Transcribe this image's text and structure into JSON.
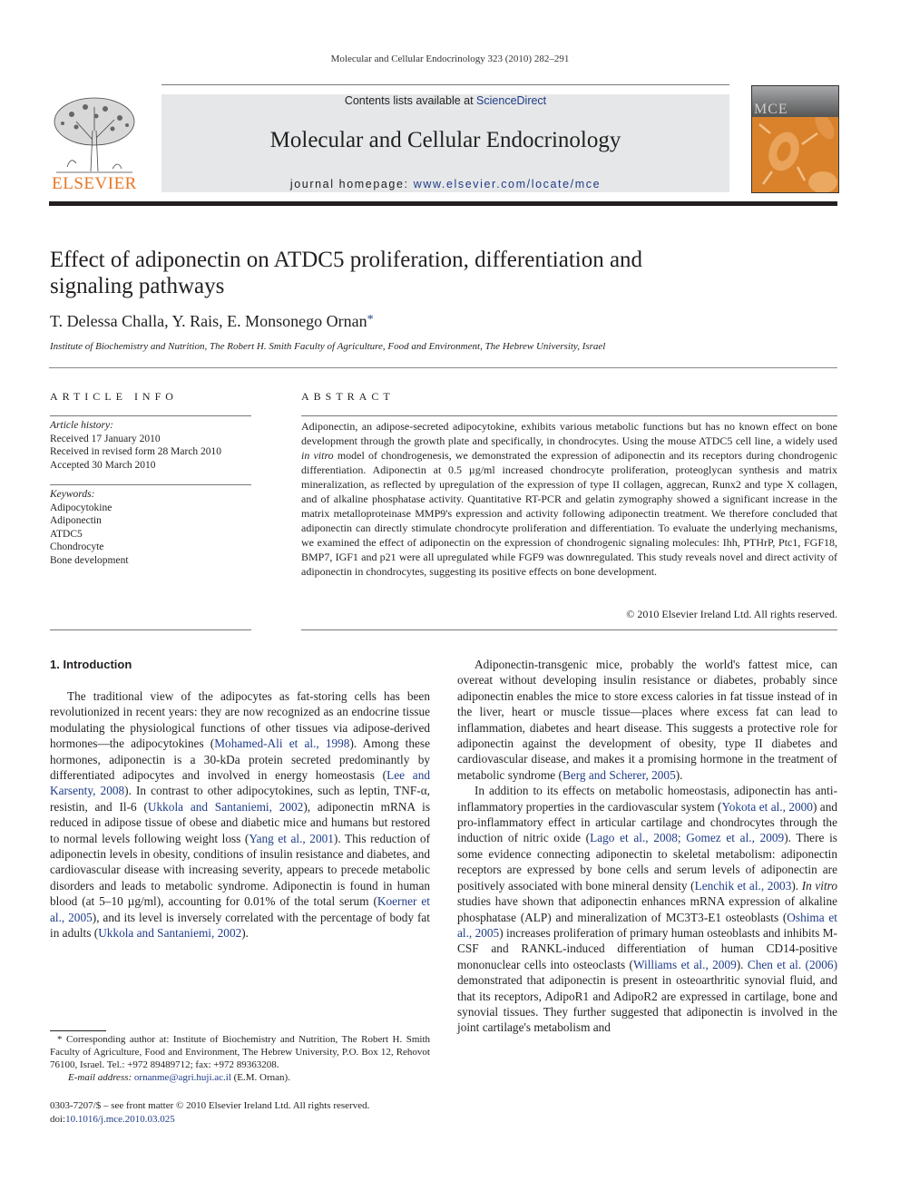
{
  "running_head": "Molecular and Cellular Endocrinology 323 (2010) 282–291",
  "banner": {
    "contents_prefix": "Contents lists available at ",
    "contents_link": "ScienceDirect",
    "journal_title": "Molecular and Cellular Endocrinology",
    "homepage_prefix": "journal homepage: ",
    "homepage_link": "www.elsevier.com/locate/mce"
  },
  "publisher_logo_text": "ELSEVIER",
  "cover": {
    "label": "MCE"
  },
  "article": {
    "title": "Effect of adiponectin on ATDC5 proliferation, differentiation and signaling pathways",
    "authors": "T. Delessa Challa, Y. Rais, E. Monsonego Ornan",
    "author_mark": "*",
    "affiliation": "Institute of Biochemistry and Nutrition, The Robert H. Smith Faculty of Agriculture, Food and Environment, The Hebrew University, Israel"
  },
  "article_info": {
    "heading": "ARTICLE INFO",
    "history_label": "Article history:",
    "history": [
      "Received 17 January 2010",
      "Received in revised form 28 March 2010",
      "Accepted 30 March 2010"
    ],
    "keywords_label": "Keywords:",
    "keywords": [
      "Adipocytokine",
      "Adiponectin",
      "ATDC5",
      "Chondrocyte",
      "Bone development"
    ]
  },
  "abstract": {
    "heading": "ABSTRACT",
    "text_1": "Adiponectin, an adipose-secreted adipocytokine, exhibits various metabolic functions but has no known effect on bone development through the growth plate and specifically, in chondrocytes. Using the mouse ATDC5 cell line, a widely used ",
    "text_italic": "in vitro",
    "text_2": " model of chondrogenesis, we demonstrated the expression of adiponectin and its receptors during chondrogenic differentiation. Adiponectin at 0.5 µg/ml increased chondrocyte proliferation, proteoglycan synthesis and matrix mineralization, as reflected by upregulation of the expression of type II collagen, aggrecan, Runx2 and type X collagen, and of alkaline phosphatase activity. Quantitative RT-PCR and gelatin zymography showed a significant increase in the matrix metalloproteinase MMP9's expression and activity following adiponectin treatment. We therefore concluded that adiponectin can directly stimulate chondrocyte proliferation and differentiation. To evaluate the underlying mechanisms, we examined the effect of adiponectin on the expression of chondrogenic signaling molecules: Ihh, PTHrP, Ptc1, FGF18, BMP7, IGF1 and p21 were all upregulated while FGF9 was downregulated. This study reveals novel and direct activity of adiponectin in chondrocytes, suggesting its positive effects on bone development.",
    "copyright": "© 2010 Elsevier Ireland Ltd. All rights reserved."
  },
  "intro": {
    "heading": "1.  Introduction",
    "left_p1": [
      {
        "t": "The traditional view of the adipocytes as fat-storing cells has been revolutionized in recent years: they are now recognized as an endocrine tissue modulating the physiological functions of other tissues via adipose-derived hormones—the adipocytokines ("
      },
      {
        "r": "Mohamed-Ali et al., 1998"
      },
      {
        "t": "). Among these hormones, adiponectin is a 30-kDa protein secreted predominantly by differentiated adipocytes and involved in energy homeostasis ("
      },
      {
        "r": "Lee and Karsenty, 2008"
      },
      {
        "t": "). In contrast to other adipocytokines, such as leptin, TNF-α, resistin, and Il-6 ("
      },
      {
        "r": "Ukkola and Santaniemi, 2002"
      },
      {
        "t": "), adiponectin mRNA is reduced in adipose tissue of obese and diabetic mice and humans but restored to normal levels following weight loss ("
      },
      {
        "r": "Yang et al., 2001"
      },
      {
        "t": "). This reduction of adiponectin levels in obesity, conditions of insulin resistance and diabetes, and cardiovascular disease with increasing severity, appears to precede metabolic disorders and leads to metabolic syndrome. Adiponectin is found in human blood (at 5–10 µg/ml), accounting for 0.01% of the total serum ("
      },
      {
        "r": "Koerner et al., 2005"
      },
      {
        "t": "), and its level is inversely correlated with the percentage of body fat in adults ("
      },
      {
        "r": "Ukkola and Santaniemi, 2002"
      },
      {
        "t": ")."
      }
    ],
    "right_p1": [
      {
        "t": "Adiponectin-transgenic mice, probably the world's fattest mice, can overeat without developing insulin resistance or diabetes, probably since adiponectin enables the mice to store excess calories in fat tissue instead of in the liver, heart or muscle tissue—places where excess fat can lead to inflammation, diabetes and heart disease. This suggests a protective role for adiponectin against the development of obesity, type II diabetes and cardiovascular disease, and makes it a promising hormone in the treatment of metabolic syndrome ("
      },
      {
        "r": "Berg and Scherer, 2005"
      },
      {
        "t": ")."
      }
    ],
    "right_p2": [
      {
        "t": "In addition to its effects on metabolic homeostasis, adiponectin has anti-inflammatory properties in the cardiovascular system ("
      },
      {
        "r": "Yokota et al., 2000"
      },
      {
        "t": ") and pro-inflammatory effect in articular cartilage and chondrocytes through the induction of nitric oxide ("
      },
      {
        "r": "Lago et al., 2008; Gomez et al., 2009"
      },
      {
        "t": "). There is some evidence connecting adiponectin to skeletal metabolism: adiponectin receptors are expressed by bone cells and serum levels of adiponectin are positively associated with bone mineral density ("
      },
      {
        "r": "Lenchik et al., 2003"
      },
      {
        "t": "). "
      },
      {
        "i": "In vitro"
      },
      {
        "t": " studies have shown that adiponectin enhances mRNA expression of alkaline phosphatase (ALP) and mineralization of MC3T3-E1 osteoblasts ("
      },
      {
        "r": "Oshima et al., 2005"
      },
      {
        "t": ") increases proliferation of primary human osteoblasts and inhibits M-CSF and RANKL-induced differentiation of human CD14-positive mononuclear cells into osteoclasts ("
      },
      {
        "r": "Williams et al., 2009"
      },
      {
        "t": "). "
      },
      {
        "r": "Chen et al. (2006)"
      },
      {
        "t": " demonstrated that adiponectin is present in osteoarthritic synovial fluid, and that its receptors, AdipoR1 and AdipoR2 are expressed in cartilage, bone and synovial tissues. They further suggested that adiponectin is involved in the joint cartilage's metabolism and"
      }
    ]
  },
  "footnote": {
    "corresponding": "* Corresponding author at: Institute of Biochemistry and Nutrition, The Robert H. Smith Faculty of Agriculture, Food and Environment, The Hebrew University, P.O. Box 12, Rehovot 76100, Israel. Tel.: +972 89489712; fax: +972 89363208.",
    "email_label": "E-mail address: ",
    "email": "ornanme@agri.huji.ac.il",
    "email_suffix": " (E.M. Ornan)."
  },
  "issn_line": "0303-7207/$ – see front matter © 2010 Elsevier Ireland Ltd. All rights reserved.",
  "doi_label": "doi:",
  "doi": "10.1016/j.mce.2010.03.025"
}
